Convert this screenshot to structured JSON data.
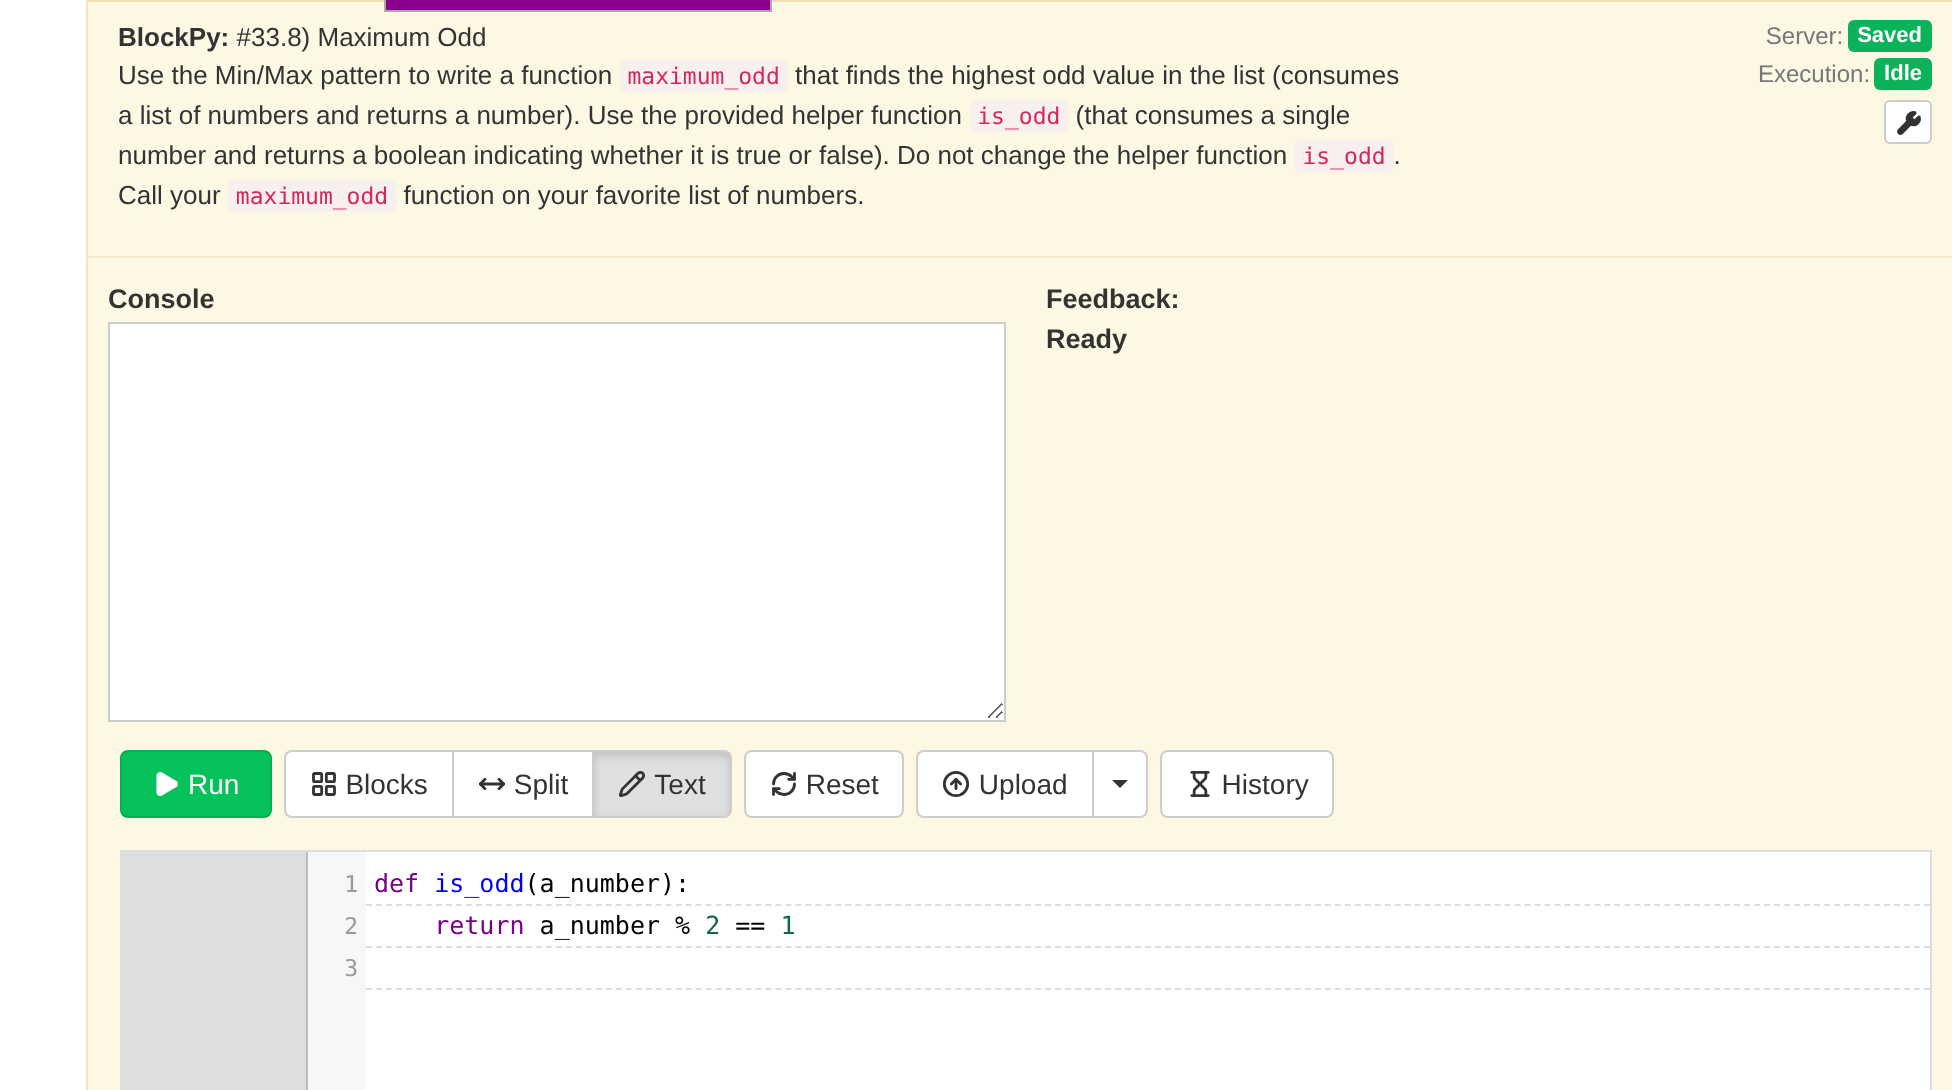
{
  "assignment": {
    "brand": "BlockPy:",
    "title": "#33.8) Maximum Odd",
    "description": [
      {
        "kind": "text",
        "text": "Use the Min/Max pattern to write a function "
      },
      {
        "kind": "code",
        "text": "maximum_odd"
      },
      {
        "kind": "text",
        "text": " that finds the highest odd value in the list (consumes a list of numbers and returns a number). Use the provided helper function "
      },
      {
        "kind": "code",
        "text": "is_odd"
      },
      {
        "kind": "text",
        "text": " (that consumes a single number and returns a boolean indicating whether it is true or false). Do not change the helper function "
      },
      {
        "kind": "code",
        "text": "is_odd"
      },
      {
        "kind": "text",
        "text": ". Call your "
      },
      {
        "kind": "code",
        "text": "maximum_odd"
      },
      {
        "kind": "text",
        "text": " function on your favorite list of numbers."
      }
    ]
  },
  "status": [
    {
      "label": "Server:",
      "value": "Saved"
    },
    {
      "label": "Execution:",
      "value": "Idle"
    }
  ],
  "console": {
    "title": "Console"
  },
  "feedback": {
    "title": "Feedback:",
    "message": "Ready"
  },
  "toolbar": [
    {
      "kind": "run",
      "label": "Run"
    },
    {
      "kind": "group",
      "buttons": [
        {
          "label": "Blocks",
          "selected": false
        },
        {
          "label": "Split",
          "selected": false
        },
        {
          "label": "Text",
          "selected": true
        }
      ]
    },
    {
      "kind": "plain",
      "label": "Reset"
    },
    {
      "kind": "split",
      "label": "Upload"
    },
    {
      "kind": "plain",
      "label": "History"
    }
  ],
  "editor": {
    "lines": [
      {
        "number": "1",
        "tokens": [
          {
            "kind": "keyword",
            "text": "def"
          },
          {
            "kind": "def",
            "text": " is_odd"
          },
          {
            "kind": "plain",
            "text": "(a_number):"
          }
        ]
      },
      {
        "number": "2",
        "tokens": [
          {
            "kind": "keyword",
            "text": "    return"
          },
          {
            "kind": "plain",
            "text": " a_number % "
          },
          {
            "kind": "number",
            "text": "2"
          },
          {
            "kind": "plain",
            "text": " == "
          },
          {
            "kind": "number",
            "text": "1"
          }
        ]
      },
      {
        "number": "3"
      }
    ]
  }
}
